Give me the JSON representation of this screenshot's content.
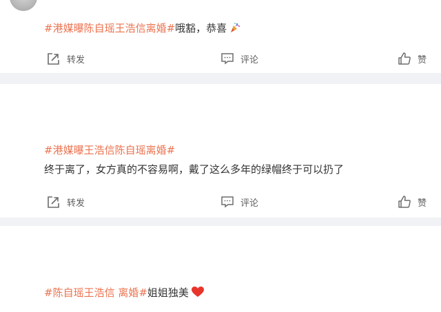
{
  "posts": [
    {
      "tag": "#港媒曝陈自瑶王浩信离婚#",
      "text": "哦豁，恭喜",
      "emoji": "party-popper-icon"
    },
    {
      "tag": "#港媒曝王浩信陈自瑶离婚#",
      "text": "终于离了，女方真的不容易啊，戴了这么多年的绿帽终于可以扔了",
      "emoji": ""
    },
    {
      "tag1": "#陈自瑶王浩信 离婚#",
      "tag2": "姐姐独美",
      "emoji": "red-heart-icon"
    }
  ],
  "actions": {
    "repost": "转发",
    "comment": "评论",
    "like": "赞"
  },
  "colors": {
    "hashtag": "#eb7350",
    "text": "#333333",
    "action_text": "#5f5f5f",
    "separator": "#f1f2f5",
    "heart": "#e8352c"
  }
}
